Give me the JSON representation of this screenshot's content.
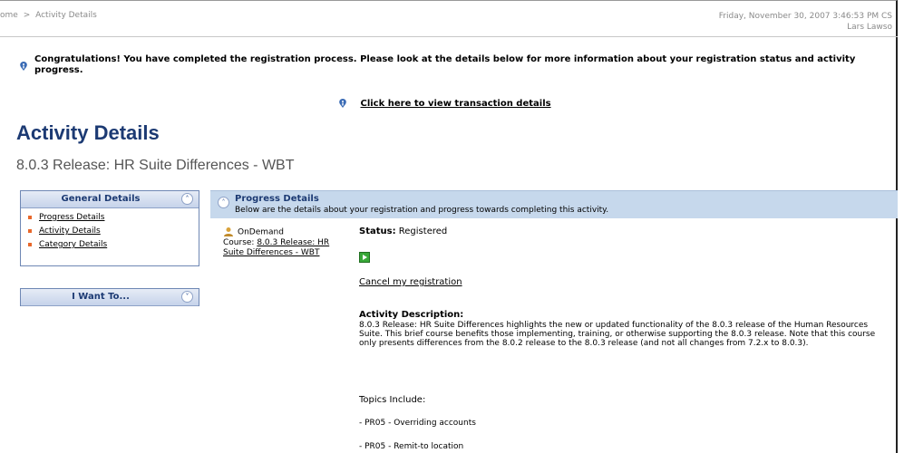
{
  "breadcrumb": {
    "home": "ome",
    "separator": ">",
    "current": "Activity Details"
  },
  "datetime": {
    "date_time": "Friday, November 30, 2007 3:46:53 PM CS",
    "user": "Lars Lawso"
  },
  "congrats_message": "Congratulations! You have completed the registration process. Please look at the details below for more information about your registration status and activity progress.",
  "transaction_link": "Click here to view transaction details",
  "page_title": "Activity Details",
  "activity_name": "8.0.3 Release: HR Suite Differences - WBT",
  "general_details": {
    "title": "General Details",
    "items": [
      {
        "label": "Progress Details"
      },
      {
        "label": "Activity Details"
      },
      {
        "label": "Category Details"
      }
    ]
  },
  "i_want_to": {
    "title": "I Want To..."
  },
  "progress": {
    "title": "Progress Details",
    "subtitle": "Below are the details about your registration and progress towards completing this activity."
  },
  "course": {
    "delivery": "OnDemand",
    "prefix": "Course:",
    "link": "8.0.3 Release: HR Suite Differences - WBT"
  },
  "status": {
    "label": "Status:",
    "value": "Registered"
  },
  "cancel_link": "Cancel my registration",
  "description": {
    "title": "Activity Description:",
    "text": "8.0.3 Release: HR Suite Differences highlights the new or updated functionality of the 8.0.3 release of the Human Resources Suite. This brief course benefits those implementing, training, or otherwise supporting the 8.0.3 release. Note that this course only presents differences from the 8.0.2 release to the 8.0.3 release (and not all changes from 7.2.x to 8.0.3)."
  },
  "topics": {
    "title": "Topics Include:",
    "items": [
      "- PR05 - Overriding accounts",
      "- PR05 - Remit-to location"
    ]
  },
  "icons": {
    "info": "info-icon",
    "collapse": "collapse-up-icon",
    "expand": "expand-down-icon",
    "course": "course-person-icon",
    "launch": "launch-arrow-icon"
  },
  "colors": {
    "title": "#1c3a73",
    "panel_border": "#6e87b4",
    "progress_header_bg": "#c6d8ec",
    "bullet": "#e8682b",
    "launch": "#38a838"
  }
}
